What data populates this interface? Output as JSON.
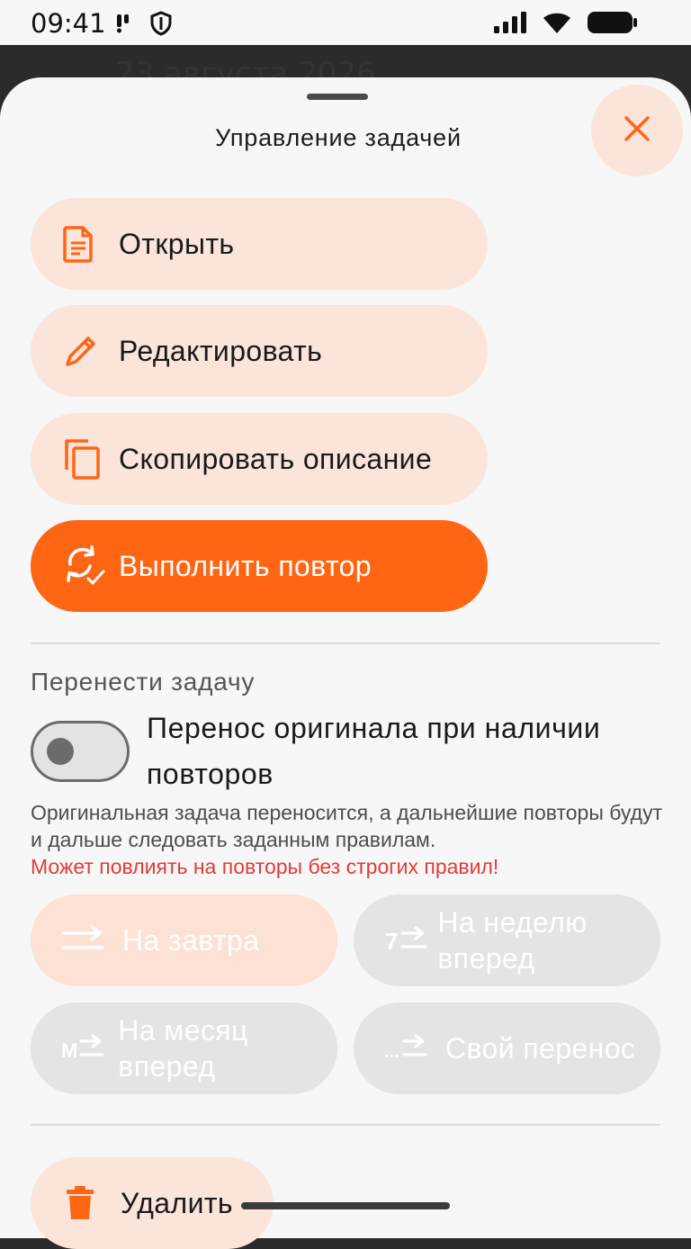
{
  "status_bar": {
    "time": "09:41"
  },
  "backdrop": {
    "date_text": "23 августа 2026"
  },
  "sheet": {
    "title": "Управление задачей"
  },
  "actions": {
    "open": "Открыть",
    "edit": "Редактировать",
    "copy_description": "Скопировать описание",
    "complete_repeat": "Выполнить повтор"
  },
  "move": {
    "section_label": "Перенести задачу",
    "toggle_label": "Перенос оригинала при наличии повторов",
    "toggle_on": false,
    "hint": "Оригинальная задача переносится, а дальнейшие повторы будут и дальше следовать заданным правилам.",
    "warning": "Может повлиять на повторы без строгих правил!",
    "tomorrow": "На завтра",
    "week_ahead": "На неделю вперед",
    "month_ahead": "На месяц вперед",
    "custom": "Свой перенос",
    "week_icon_text": "7",
    "month_icon_text": "M",
    "custom_icon_text": "..."
  },
  "delete": {
    "label": "Удалить"
  },
  "colors": {
    "accent": "#ff6614",
    "accent_light": "#fbe4da",
    "warning": "#e23b3b",
    "disabled": "#e4e4e4"
  }
}
